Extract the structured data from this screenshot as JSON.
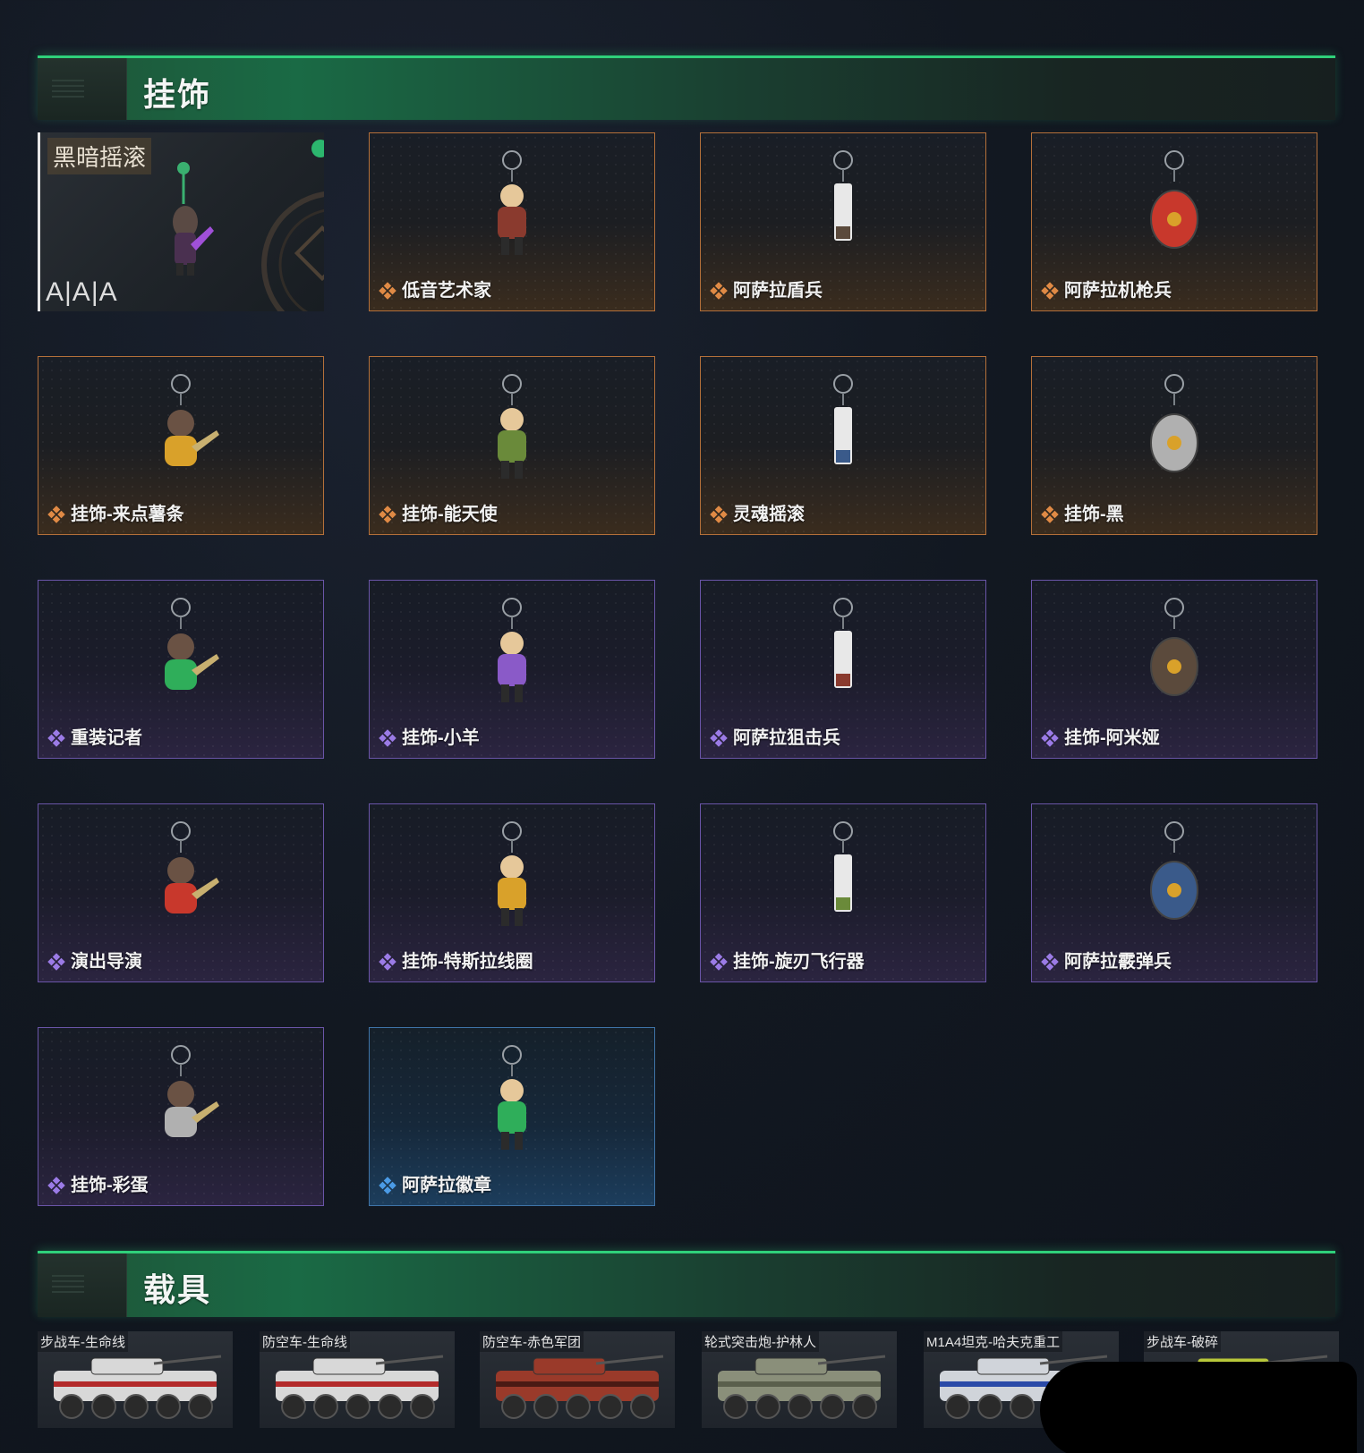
{
  "sections": {
    "charms_title": "挂饰",
    "vehicles_title": "载具"
  },
  "featured": {
    "title": "黑暗摇滚",
    "mark": "A|A|A"
  },
  "charms": [
    {
      "label": "低音艺术家",
      "rarity": "orange"
    },
    {
      "label": "阿萨拉盾兵",
      "rarity": "orange"
    },
    {
      "label": "阿萨拉机枪兵",
      "rarity": "orange"
    },
    {
      "label": "挂饰-来点薯条",
      "rarity": "orange"
    },
    {
      "label": "挂饰-能天使",
      "rarity": "orange"
    },
    {
      "label": "灵魂摇滚",
      "rarity": "orange"
    },
    {
      "label": "挂饰-黑",
      "rarity": "orange"
    },
    {
      "label": "重装记者",
      "rarity": "purple"
    },
    {
      "label": "挂饰-小羊",
      "rarity": "purple"
    },
    {
      "label": "阿萨拉狙击兵",
      "rarity": "purple"
    },
    {
      "label": "挂饰-阿米娅",
      "rarity": "purple"
    },
    {
      "label": "演出导演",
      "rarity": "purple"
    },
    {
      "label": "挂饰-特斯拉线圈",
      "rarity": "purple"
    },
    {
      "label": "挂饰-旋刃飞行器",
      "rarity": "purple"
    },
    {
      "label": "阿萨拉霰弹兵",
      "rarity": "purple"
    },
    {
      "label": "挂饰-彩蛋",
      "rarity": "purple"
    },
    {
      "label": "阿萨拉徽章",
      "rarity": "blue"
    }
  ],
  "vehicles": [
    {
      "label": "步战车-生命线"
    },
    {
      "label": "防空车-生命线"
    },
    {
      "label": "防空车-赤色军团"
    },
    {
      "label": "轮式突击炮-护林人"
    },
    {
      "label": "M1A4坦克-哈夫克重工"
    },
    {
      "label": "步战车-破碎"
    }
  ],
  "colors": {
    "orange": "#e08a45",
    "purple": "#9b7be6",
    "blue": "#4b9be6",
    "accent_green": "#2fd07a"
  }
}
